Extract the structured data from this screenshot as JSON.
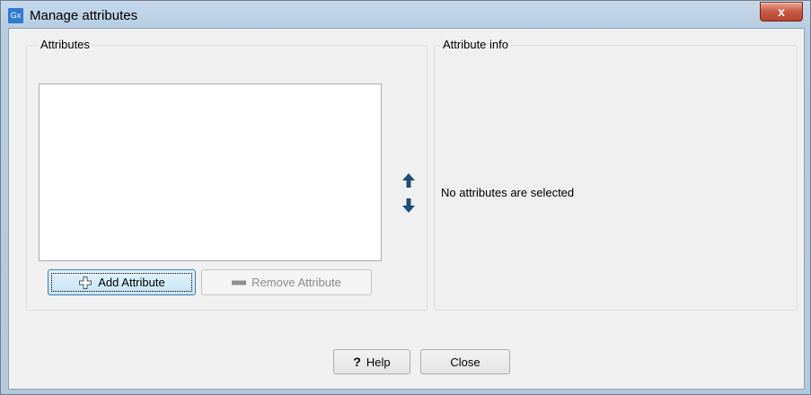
{
  "window": {
    "title": "Manage attributes",
    "app_icon_text": "Gx",
    "close_glyph": "x"
  },
  "attributes_group": {
    "label": "Attributes"
  },
  "info_group": {
    "label": "Attribute info",
    "message": "No attributes are selected"
  },
  "buttons": {
    "add_attribute": "Add Attribute",
    "remove_attribute": "Remove Attribute",
    "help": "Help",
    "close": "Close"
  },
  "icons": {
    "move_up": "arrow-up-icon",
    "move_down": "arrow-down-icon",
    "add": "plus-outline-icon",
    "remove": "minus-icon",
    "help": "question-mark-icon"
  },
  "colors": {
    "arrow": "#1f4e79",
    "title_gradient": "#b7cce1",
    "close_red": "#c75a45"
  }
}
